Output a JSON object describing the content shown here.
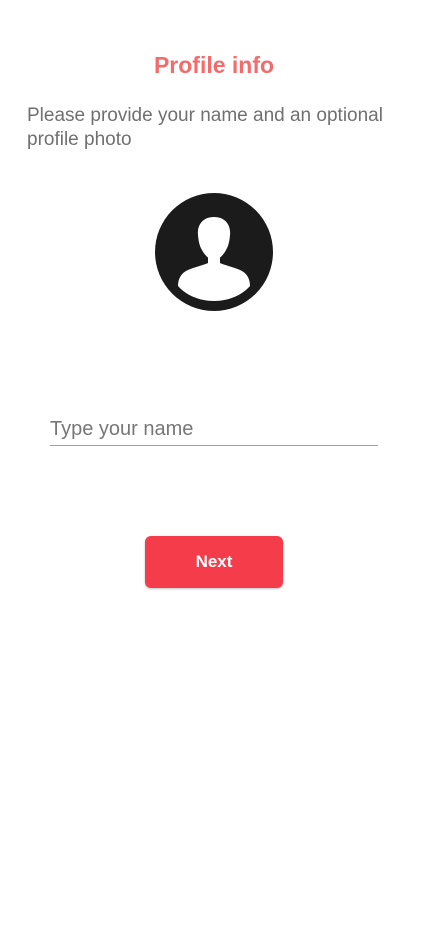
{
  "colors": {
    "title": "#f36b6b",
    "accent": "#f53c4a",
    "underline": "#f08080",
    "avatar_bg": "#1b1b1b",
    "avatar_figure": "#ffffff"
  },
  "header": {
    "title": "Profile info",
    "subtitle": "Please provide your name and an optional profile photo"
  },
  "avatar": {
    "icon": "default-profile-icon"
  },
  "form": {
    "name_value": "",
    "name_placeholder": "Type your name"
  },
  "actions": {
    "next_label": "Next"
  }
}
